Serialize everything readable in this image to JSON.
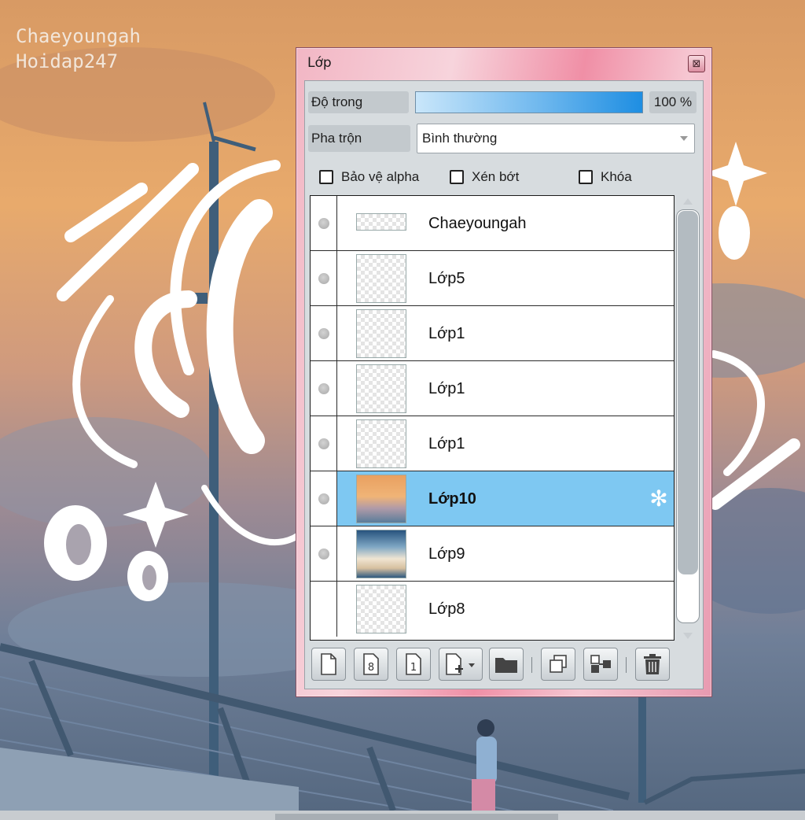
{
  "watermark": {
    "line1": "Chaeyoungah",
    "line2": "Hoidap247"
  },
  "panel": {
    "title": "Lớp",
    "close_icon": "close-icon",
    "opacity": {
      "label": "Độ trong",
      "value_text": "100 %",
      "value": 100
    },
    "blend": {
      "label": "Pha trộn",
      "value": "Bình thường"
    },
    "checkboxes": [
      {
        "label": "Bảo vệ alpha",
        "checked": false
      },
      {
        "label": "Xén bớt",
        "checked": false
      },
      {
        "label": "Khóa",
        "checked": false
      }
    ],
    "layers": [
      {
        "name": "Chaeyoungah",
        "visible": true,
        "selected": false
      },
      {
        "name": "Lớp5",
        "visible": true,
        "selected": false
      },
      {
        "name": "Lớp1",
        "visible": true,
        "selected": false
      },
      {
        "name": "Lớp1",
        "visible": true,
        "selected": false
      },
      {
        "name": "Lớp1",
        "visible": true,
        "selected": false
      },
      {
        "name": "Lớp10",
        "visible": true,
        "selected": true
      },
      {
        "name": "Lớp9",
        "visible": true,
        "selected": false
      },
      {
        "name": "Lớp8",
        "visible": false,
        "selected": false
      }
    ],
    "toolbar": {
      "buttons": [
        {
          "icon": "new-layer-icon"
        },
        {
          "icon": "new-8bit-layer-icon",
          "glyph": "8"
        },
        {
          "icon": "new-1bit-layer-icon",
          "glyph": "1"
        },
        {
          "icon": "add-layer-menu-icon"
        },
        {
          "icon": "folder-icon"
        },
        {
          "icon": "duplicate-layer-icon"
        },
        {
          "icon": "merge-layer-icon"
        },
        {
          "icon": "trash-icon"
        }
      ]
    },
    "colors": {
      "selected_row": "#7ec8f2",
      "frame": "#f08fa6"
    }
  }
}
